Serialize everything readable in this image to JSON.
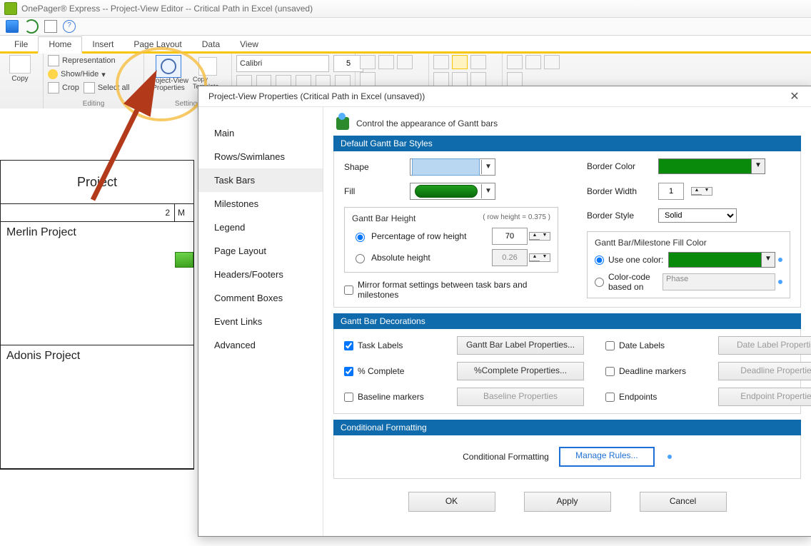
{
  "titlebar": "OnePager® Express --  Project-View Editor -- Critical Path in Excel (unsaved)",
  "menu": {
    "file": "File",
    "home": "Home",
    "insert": "Insert",
    "page": "Page Layout",
    "data": "Data",
    "view": "View"
  },
  "ribbon": {
    "copy": "Copy",
    "repr": "Representation",
    "showhide": "Show/Hide",
    "crop": "Crop",
    "selectall": "Select all",
    "editing": "Editing",
    "pvprop": "Project-View Properties",
    "copytmpl": "Copy Template",
    "settings": "Settings",
    "font": "Calibri",
    "size": "5"
  },
  "sheet": {
    "header": "Project",
    "sub": "M",
    "row1": "Merlin Project",
    "row2": "Adonis Project",
    "col2": "2"
  },
  "dialog": {
    "title": "Project-View Properties (Critical Path in Excel (unsaved))",
    "nav": [
      "Main",
      "Rows/Swimlanes",
      "Task Bars",
      "Milestones",
      "Legend",
      "Page Layout",
      "Headers/Footers",
      "Comment Boxes",
      "Event Links",
      "Advanced"
    ],
    "navSelected": 2,
    "paneHdr": "Control the appearance of Gantt bars",
    "sec1": "Default Gantt Bar Styles",
    "shape": "Shape",
    "fill": "Fill",
    "gbh": {
      "title": "Gantt Bar Height",
      "hint": "( row height =    0.375 )",
      "r1": "Percentage of row height",
      "v1": "70",
      "r2": "Absolute height",
      "v2": "0.26"
    },
    "bc": "Border Color",
    "bw": "Border Width",
    "bwv": "1",
    "bs": "Border Style",
    "bsV": "Solid",
    "fillGrp": {
      "title": "Gantt Bar/Milestone Fill Color",
      "r1": "Use one color:",
      "r2": "Color-code based on",
      "phase": "Phase"
    },
    "mirror": "Mirror format settings between task bars and milestones",
    "sec2": "Gantt Bar Decorations",
    "deco": {
      "taskLabels": "Task Labels",
      "pct": "% Complete",
      "baseline": "Baseline markers",
      "btn1": "Gantt Bar Label Properties...",
      "btn2": "%Complete Properties...",
      "btn3": "Baseline Properties",
      "dateLabels": "Date Labels",
      "deadline": "Deadline markers",
      "endpoints": "Endpoints",
      "btn4": "Date Label Properties...",
      "btn5": "Deadline Properties...",
      "btn6": "Endpoint Properties..."
    },
    "sec3": "Conditional Formatting",
    "condLabel": "Conditional Formatting",
    "manage": "Manage Rules...",
    "ok": "OK",
    "apply": "Apply",
    "cancel": "Cancel"
  }
}
